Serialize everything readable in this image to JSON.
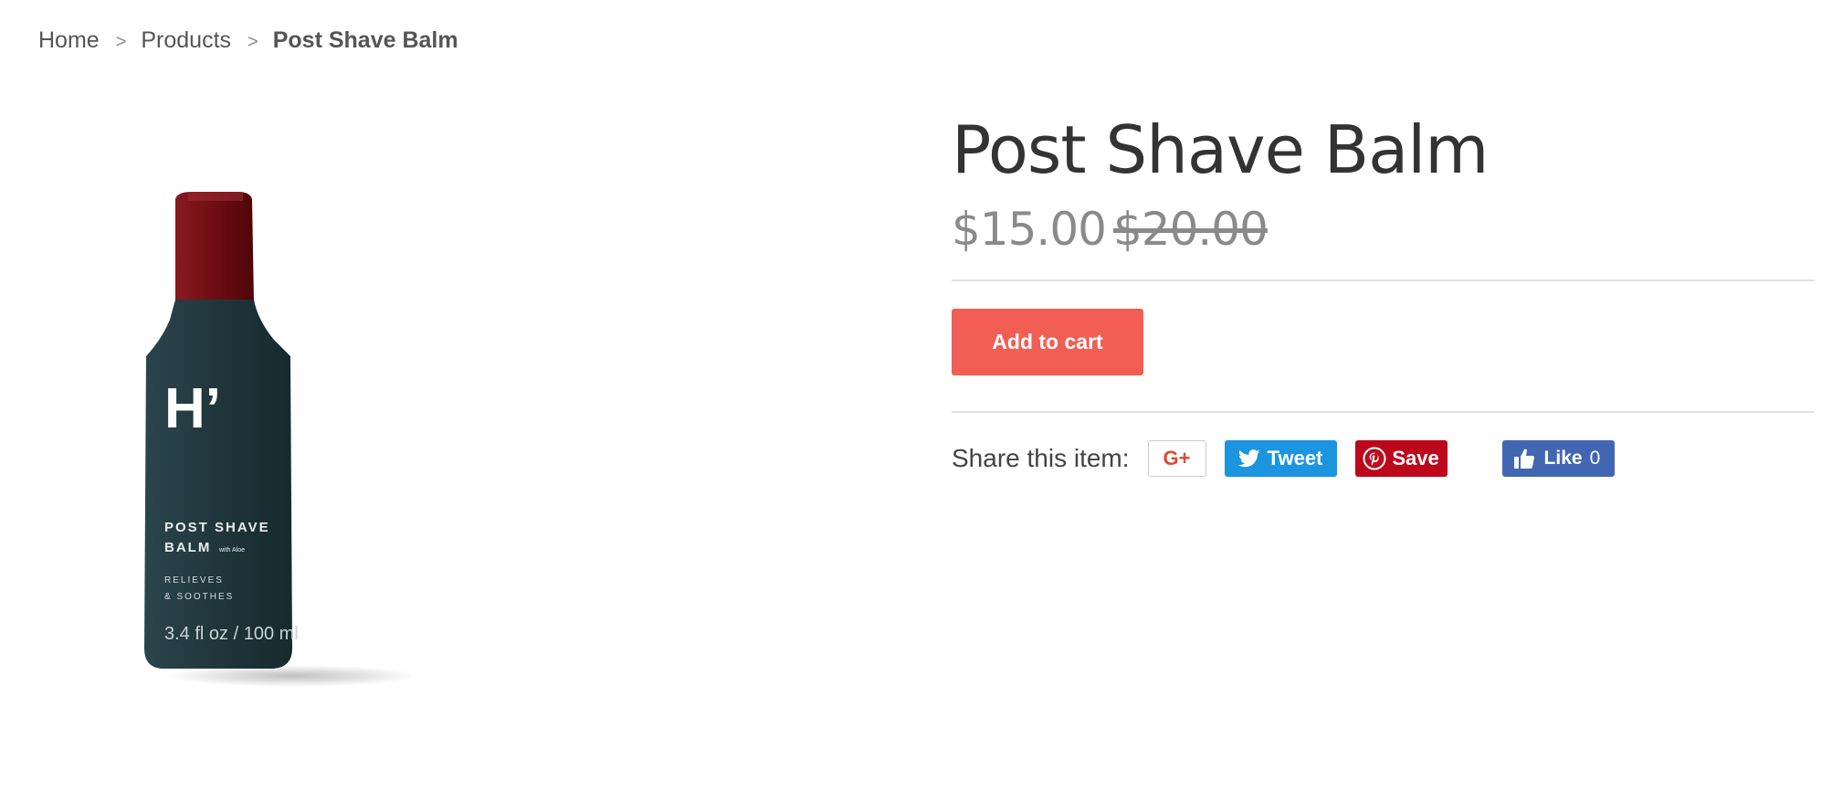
{
  "breadcrumb": {
    "home": "Home",
    "separator": ">",
    "products": "Products",
    "current": "Post Shave Balm"
  },
  "product": {
    "title": "Post Shave Balm",
    "price": "$15.00",
    "compare_price": "$20.00",
    "add_to_cart_label": "Add to cart",
    "image": {
      "brand_mark": "H’",
      "line1": "POST SHAVE",
      "line2": "BALM",
      "line2_sub": "with Aloe",
      "line3": "RELIEVES",
      "line4": "& SOOTHES",
      "volume": "3.4 fl oz / 100 ml",
      "cap_color": "#6e0d12",
      "bottle_color": "#21373d"
    }
  },
  "share": {
    "label": "Share this item:",
    "google_plus_label": "G+",
    "tweet_label": "Tweet",
    "pinterest_label": "Save",
    "like_label": "Like",
    "like_count": "0"
  },
  "colors": {
    "add_to_cart": "#f25d54",
    "twitter": "#1b95e0",
    "pinterest": "#bd081c",
    "facebook": "#4267b2",
    "google": "#dd4b39"
  }
}
